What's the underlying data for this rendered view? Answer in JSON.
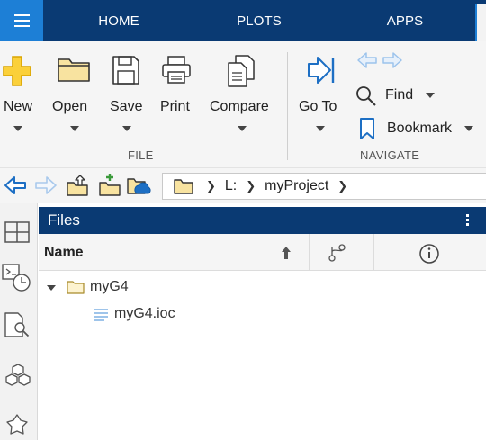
{
  "tabs": [
    {
      "label": "HOME"
    },
    {
      "label": "PLOTS"
    },
    {
      "label": "APPS"
    }
  ],
  "toolstrip": {
    "file_group": {
      "label": "FILE",
      "tools": [
        {
          "label": "New",
          "icon": "plus-icon"
        },
        {
          "label": "Open",
          "icon": "folder-icon"
        },
        {
          "label": "Save",
          "icon": "floppy-disk-icon"
        },
        {
          "label": "Print",
          "icon": "printer-icon"
        },
        {
          "label": "Compare",
          "icon": "compare-documents-icon"
        }
      ]
    },
    "navigate_group": {
      "label": "NAVIGATE",
      "goto_label": "Go To",
      "find_label": "Find",
      "bookmark_label": "Bookmark"
    }
  },
  "address_bar": {
    "path": [
      "L:",
      "myProject"
    ]
  },
  "files_panel": {
    "title": "Files",
    "columns": {
      "name": "Name"
    },
    "tree": [
      {
        "label": "myG4",
        "type": "folder",
        "expanded": true,
        "level": 0
      },
      {
        "label": "myG4.ioc",
        "type": "file",
        "level": 1
      }
    ]
  },
  "colors": {
    "tab_bar": "#0a3a73",
    "menu_button": "#1d7fd6",
    "toolstrip_bg": "#f5f5f5",
    "folder_yellow": "#f4c542",
    "icon_blue": "#1d6fc4"
  }
}
